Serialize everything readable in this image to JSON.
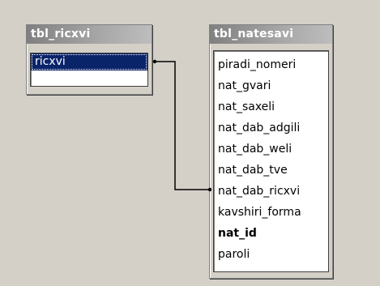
{
  "tables": {
    "left": {
      "title": "tbl_ricxvi",
      "fields": [
        "ricxvi"
      ],
      "selected_index": 0
    },
    "right": {
      "title": "tbl_natesavi",
      "fields": [
        "piradi_nomeri",
        "nat_gvari",
        "nat_saxeli",
        "nat_dab_adgili",
        "nat_dab_weli",
        "nat_dab_tve",
        "nat_dab_ricxvi",
        "kavshiri_forma",
        "nat_id",
        "paroli"
      ],
      "bold_index": 8
    }
  },
  "colors": {
    "background": "#d4d0c8",
    "title_gradient_start": "#808080",
    "selection": "#0a246a"
  }
}
